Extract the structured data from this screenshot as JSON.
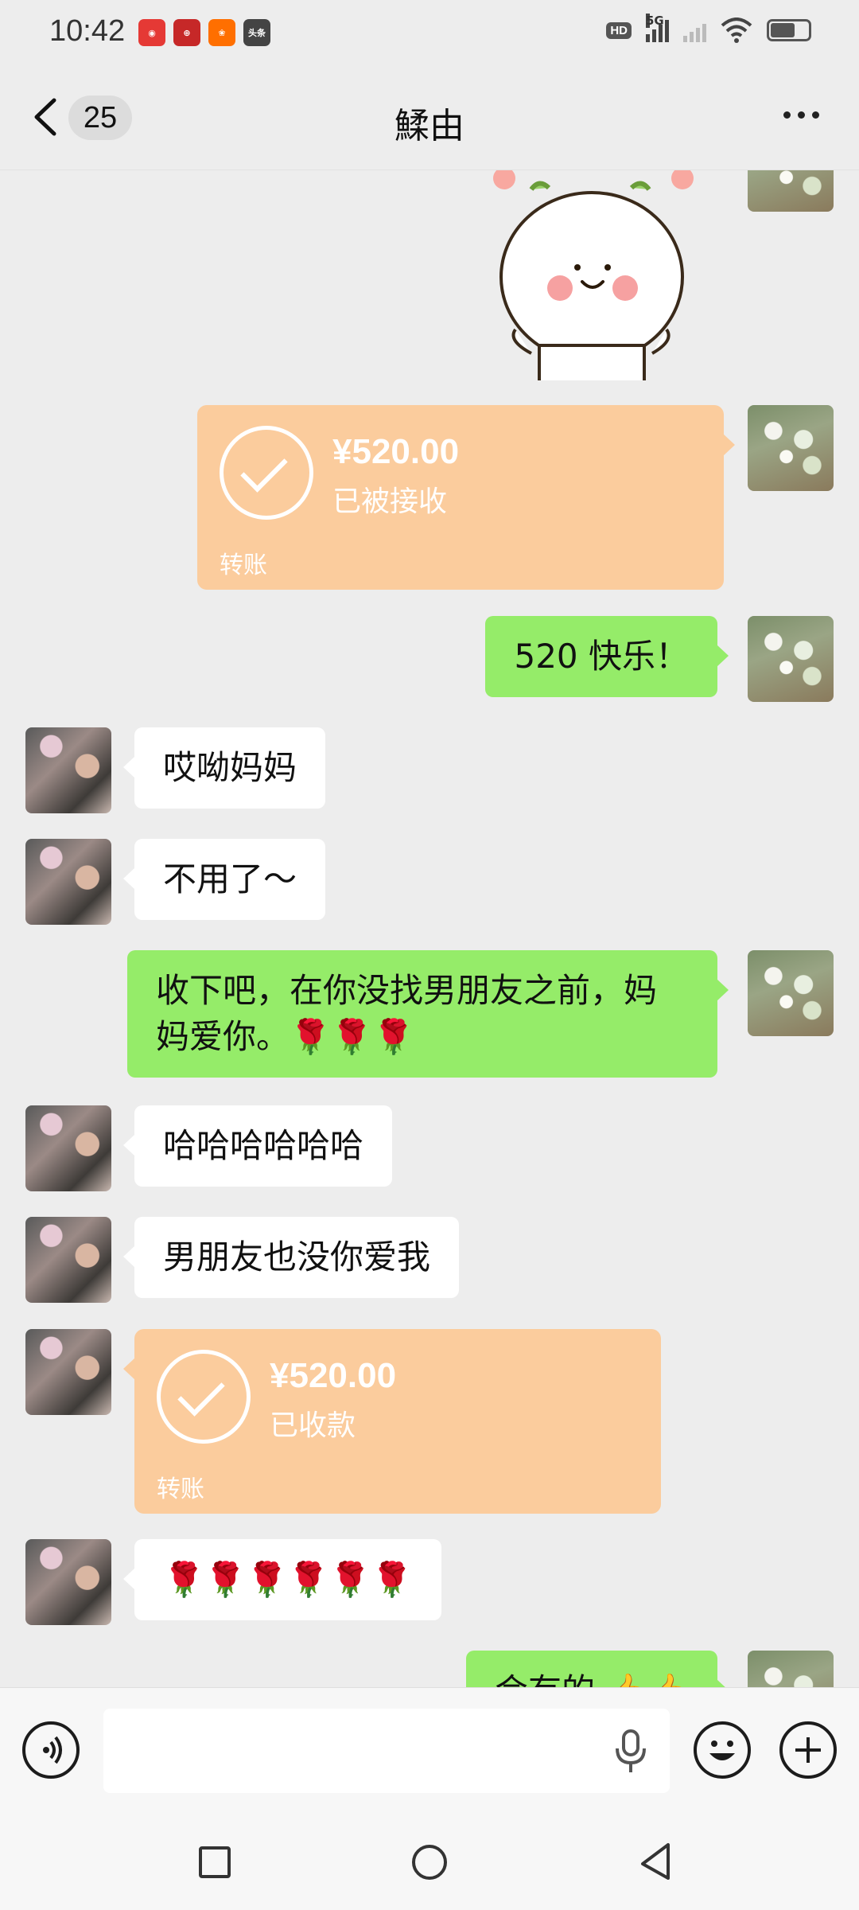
{
  "status_bar": {
    "time": "10:42",
    "app_icons": [
      "china-unicom-icon",
      "bank-icon",
      "taobao-icon",
      "toutiao-icon"
    ],
    "app_icon_labels": [
      "",
      "",
      "",
      "头条"
    ],
    "app_icon_colors": [
      "#e53935",
      "#c62828",
      "#ff6f00",
      "#444444"
    ],
    "hd": "HD",
    "network": "5G"
  },
  "header": {
    "unread_count": "25",
    "title": "鰇由"
  },
  "messages": [
    {
      "type": "sticker",
      "side": "out"
    },
    {
      "type": "transfer",
      "side": "out",
      "amount": "¥520.00",
      "status": "已被接收",
      "label": "转账"
    },
    {
      "type": "text",
      "side": "out",
      "text": "520 快乐！"
    },
    {
      "type": "text",
      "side": "in",
      "text": "哎呦妈妈"
    },
    {
      "type": "text",
      "side": "in",
      "text": "不用了～"
    },
    {
      "type": "text",
      "side": "out",
      "text": "收下吧，在你没找男朋友之前，妈妈爱你。🌹🌹🌹"
    },
    {
      "type": "text",
      "side": "in",
      "text": "哈哈哈哈哈哈"
    },
    {
      "type": "text",
      "side": "in",
      "text": "男朋友也没你爱我"
    },
    {
      "type": "transfer",
      "side": "in",
      "amount": "¥520.00",
      "status": "已收款",
      "label": "转账"
    },
    {
      "type": "text",
      "side": "in",
      "text": "🌹🌹🌹🌹🌹🌹"
    },
    {
      "type": "text",
      "side": "out",
      "text": "会有的 👍👍"
    }
  ],
  "input": {
    "value": "",
    "placeholder": ""
  },
  "colors": {
    "outgoing_bubble": "#95ec69",
    "incoming_bubble": "#ffffff",
    "transfer_card": "#fbcc9d",
    "background": "#ededed"
  }
}
